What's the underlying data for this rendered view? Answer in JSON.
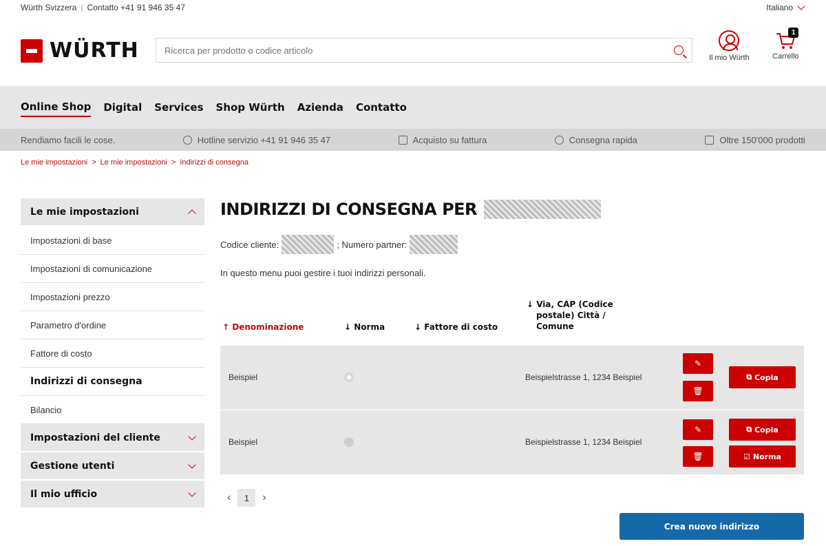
{
  "topbar": {
    "company": "Würth Svizzera",
    "contact": "Contatto +41 91 946 35 47",
    "language": "Italiano"
  },
  "header": {
    "logo_text": "WÜRTH",
    "search_placeholder": "Ricerca per prodotto o codice articolo",
    "account_label": "Il mio Würth",
    "cart_label": "Carrello",
    "cart_count": "1"
  },
  "nav": [
    "Online Shop",
    "Digital",
    "Services",
    "Shop Würth",
    "Azienda",
    "Contatto"
  ],
  "infobar": {
    "tagline": "Rendiamo facili le cose.",
    "hotline": "Hotline servizio +41 91 946 35 47",
    "invoice": "Acquisto su fattura",
    "delivery": "Consegna rapida",
    "products": "Oltre 150'000 prodotti"
  },
  "breadcrumb": [
    "Le mie impostazioni",
    "Le mie impostazioni",
    "Indirizzi di consegna"
  ],
  "sidebar": {
    "header": "Le mie impostazioni",
    "items": [
      "Impostazioni di base",
      "Impostazioni di comunicazione",
      "Impostazioni prezzo",
      "Parametro d'ordine",
      "Fattore di costo",
      "Indirizzi di consegna",
      "Bilancio"
    ],
    "groups": [
      "Impostazioni del cliente",
      "Gestione utenti",
      "Il mio ufficio"
    ]
  },
  "main": {
    "title": "INDIRIZZI DI CONSEGNA PER",
    "customer_label": "Codice cliente:",
    "partner_label": "; Numero partner:",
    "intro": "In questo menu puoi gestire i tuoi indirizzi personali.",
    "columns": [
      "↑ Denominazione",
      "↓ Norma",
      "↓ Fattore di costo",
      "↓ Via, CAP (Codice",
      "postale) Città /",
      "Comune"
    ],
    "rows": [
      {
        "name": "Beispiel",
        "address": "Beispielstrasse 1, 1234 Beispiel",
        "copy": "Copia"
      },
      {
        "name": "Beispiel",
        "address": "Beispielstrasse 1, 1234 Beispiel",
        "copy": "Copia",
        "default": "Norma"
      }
    ],
    "page": "1",
    "create_button": "Crea nuovo indirizzo"
  }
}
